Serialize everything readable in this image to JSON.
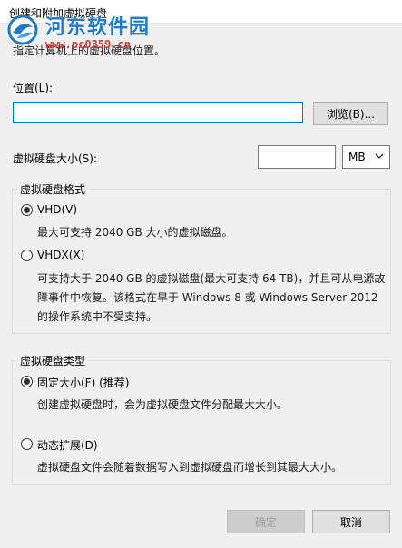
{
  "window": {
    "title": "创建和附加虚拟硬盘",
    "subtitle": "指定计算机上的虚拟硬盘位置。"
  },
  "watermark": {
    "name": "河东软件园",
    "url": "www.pc0359.cn"
  },
  "location": {
    "label": "位置(L):",
    "value": "",
    "browse_label": "浏览(B)..."
  },
  "size": {
    "label": "虚拟硬盘大小(S):",
    "value": "",
    "unit": "MB"
  },
  "format": {
    "title": "虚拟硬盘格式",
    "options": [
      {
        "label": "VHD(V)",
        "checked": true,
        "desc": "最大可支持 2040 GB 大小的虚拟磁盘。"
      },
      {
        "label": "VHDX(X)",
        "checked": false,
        "desc_lines": [
          "可支持大于 2040 GB 的虚拟磁盘(最大可支持 64 TB)，并且可从电源故",
          "障事件中恢复。该格式在早于 Windows 8 或 Windows Server 2012",
          "的操作系统中不受支持。"
        ]
      }
    ]
  },
  "type": {
    "title": "虚拟硬盘类型",
    "options": [
      {
        "label": "固定大小(F) (推荐)",
        "checked": true,
        "desc": "创建虚拟硬盘时，会为虚拟硬盘文件分配最大大小。"
      },
      {
        "label": "动态扩展(D)",
        "checked": false,
        "desc": "虚拟硬盘文件会随着数据写入到虚拟硬盘而增长到其最大大小。"
      }
    ]
  },
  "buttons": {
    "ok_label": "确定",
    "cancel_label": "取消"
  },
  "colors": {
    "accent": "#0078d7",
    "watermark_blue": "#1f7ac8",
    "watermark_red": "#d23b3b"
  }
}
